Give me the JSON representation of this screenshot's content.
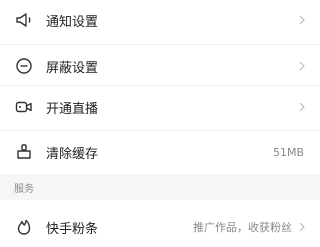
{
  "settings": {
    "items": [
      {
        "label": "通知设置",
        "icon": "megaphone-icon"
      },
      {
        "label": "屏蔽设置",
        "icon": "block-icon"
      },
      {
        "label": "开通直播",
        "icon": "video-camera-icon"
      },
      {
        "label": "清除缓存",
        "icon": "broom-icon",
        "value": "51MB"
      }
    ],
    "section_title": "服务",
    "service_item": {
      "label": "快手粉条",
      "icon": "sparkle-flame-icon",
      "value": "推广作品，收获粉丝"
    }
  },
  "colors": {
    "text": "#222222",
    "secondary_text": "#888888",
    "section_bg": "#f6f6f6",
    "divider": "#efefef"
  }
}
